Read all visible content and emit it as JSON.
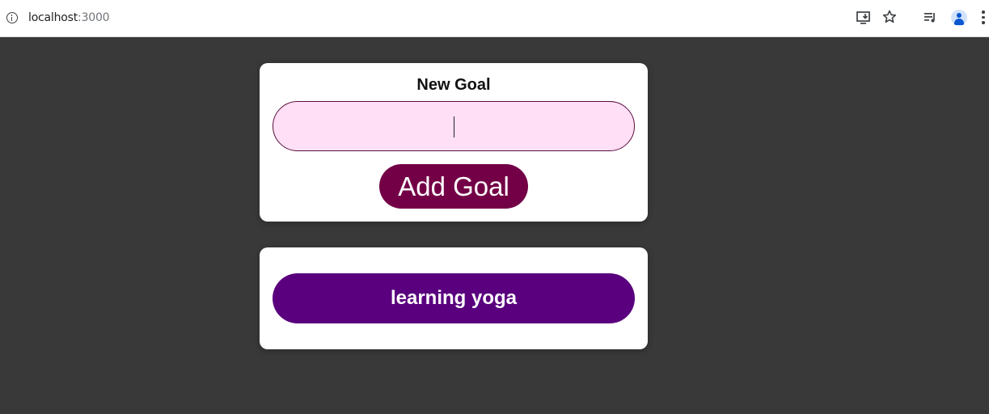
{
  "browser": {
    "url_host": "localhost",
    "url_port": ":3000",
    "icons": [
      "info-icon",
      "install-icon",
      "star-icon",
      "media-icon",
      "profile-icon",
      "menu-icon"
    ]
  },
  "form": {
    "label": "New Goal",
    "input_value": "",
    "input_placeholder": "",
    "submit_label": "Add Goal",
    "colors": {
      "input_bg": "#ffdff5",
      "input_border": "#5a0e3d",
      "button_bg": "#730046"
    }
  },
  "goals": {
    "items": [
      {
        "text": "learning yoga"
      }
    ],
    "colors": {
      "item_bg": "#5a007e"
    }
  },
  "page": {
    "background": "#393939"
  }
}
